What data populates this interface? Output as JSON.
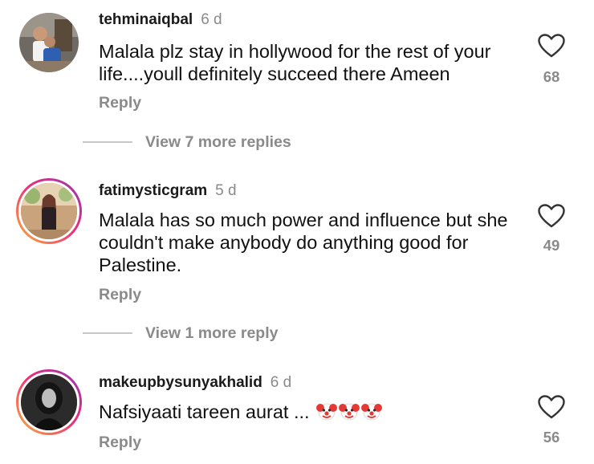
{
  "comments": [
    {
      "username": "tehminaiqbal",
      "time": "6 d",
      "text": "Malala plz stay in hollywood for the rest of your life....youll definitely succeed there Ameen",
      "reply_label": "Reply",
      "likes": "68",
      "view_more": "View 7 more replies",
      "avatar_ring": false
    },
    {
      "username": "fatimysticgram",
      "time": "5 d",
      "text": "Malala has so much power and influence but she couldn't make anybody do anything good for Palestine.",
      "reply_label": "Reply",
      "likes": "49",
      "view_more": "View 1 more reply",
      "avatar_ring": true
    },
    {
      "username": "makeupbysunyakhalid",
      "time": "6 d",
      "text": "Nafsiyaati tareen aurat ...",
      "emoji": [
        "clown-face-icon",
        "clown-face-icon",
        "clown-face-icon"
      ],
      "reply_label": "Reply",
      "likes": "56",
      "avatar_ring": true
    }
  ],
  "colors": {
    "secondary_text": "#8a8a8a",
    "story_ring_start": "#f9b232",
    "story_ring_mid": "#ee2a7b",
    "story_ring_end": "#8a3ab9"
  }
}
